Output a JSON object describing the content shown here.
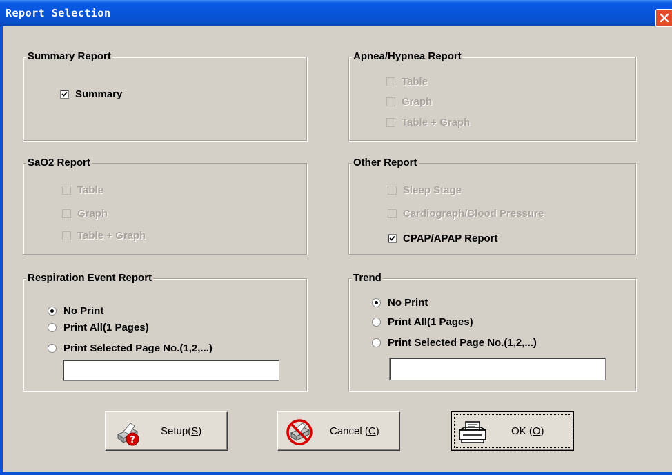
{
  "window": {
    "title": "Report Selection"
  },
  "summary_report": {
    "title": "Summary Report",
    "items": [
      {
        "label": "Summary",
        "checked": true,
        "enabled": true
      }
    ]
  },
  "apnea_report": {
    "title": "Apnea/Hypnea Report",
    "items": [
      {
        "label": "Table",
        "checked": false,
        "enabled": false
      },
      {
        "label": "Graph",
        "checked": false,
        "enabled": false
      },
      {
        "label": "Table + Graph",
        "checked": false,
        "enabled": false
      }
    ]
  },
  "sao2_report": {
    "title": "SaO2 Report",
    "items": [
      {
        "label": "Table",
        "checked": false,
        "enabled": false
      },
      {
        "label": "Graph",
        "checked": false,
        "enabled": false
      },
      {
        "label": "Table + Graph",
        "checked": false,
        "enabled": false
      }
    ]
  },
  "other_report": {
    "title": "Other Report",
    "items": [
      {
        "label": "Sleep Stage",
        "checked": false,
        "enabled": false
      },
      {
        "label": "Cardiograph/Blood Pressure",
        "checked": false,
        "enabled": false
      },
      {
        "label": "CPAP/APAP Report",
        "checked": true,
        "enabled": true
      }
    ]
  },
  "respiration_report": {
    "title": "Respiration Event Report",
    "options": [
      {
        "label": "No Print",
        "selected": true
      },
      {
        "label": "Print All(1 Pages)",
        "selected": false
      },
      {
        "label": "Print Selected Page No.(1,2,...)",
        "selected": false
      }
    ],
    "page_input_value": ""
  },
  "trend": {
    "title": "Trend",
    "options": [
      {
        "label": "No Print",
        "selected": true
      },
      {
        "label": "Print All(1 Pages)",
        "selected": false
      },
      {
        "label": "Print Selected Page No.(1,2,...)",
        "selected": false
      }
    ],
    "page_input_value": ""
  },
  "buttons": {
    "setup": {
      "label_pre": "Setup(",
      "accel": "S",
      "label_post": ")",
      "icon": "printer-help-icon"
    },
    "cancel": {
      "label_pre": "Cancel (",
      "accel": "C",
      "label_post": ")",
      "icon": "printer-no-icon"
    },
    "ok": {
      "label_pre": "OK (",
      "accel": "O",
      "label_post": ")",
      "icon": "printer-icon"
    }
  },
  "colors": {
    "titlebar": "#0854d8",
    "dialog_bg": "#d4d0c8",
    "close_button": "#e34a2b",
    "disabled_text": "#a9a59d"
  }
}
